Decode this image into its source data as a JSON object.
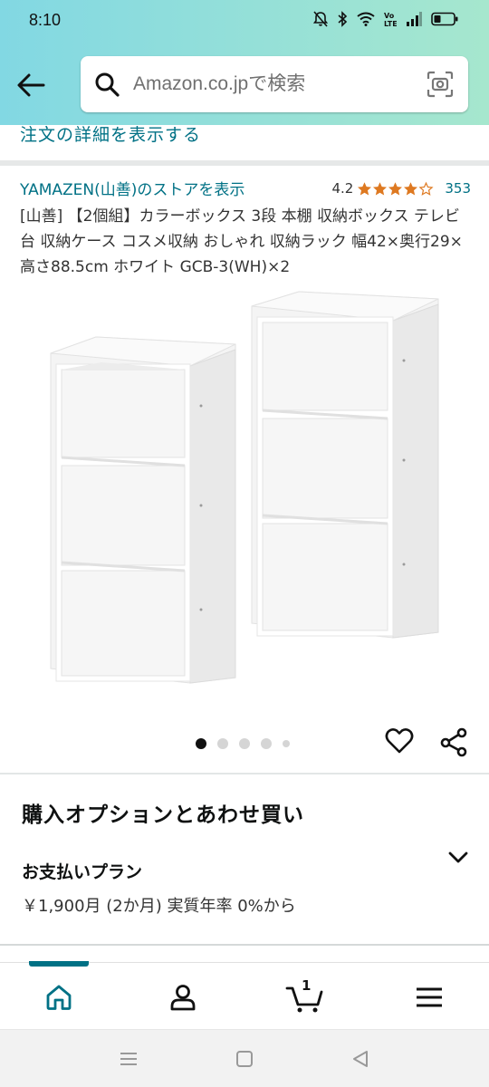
{
  "status_bar": {
    "time": "8:10",
    "icons": [
      "bell-off-icon",
      "bluetooth-icon",
      "wifi-icon",
      "volte-icon",
      "signal-icon",
      "battery-icon"
    ]
  },
  "search": {
    "placeholder": "Amazon.co.jpで検索",
    "back_icon": "back-arrow-icon",
    "search_icon": "search-icon",
    "camera_icon": "camera-scan-icon"
  },
  "order_details_link": "注文の詳細を表示する",
  "product": {
    "store_link": "YAMAZEN(山善)のストアを表示",
    "rating": "4.2",
    "rating_stars": 4.2,
    "review_count": "353",
    "title": "[山善] 【2個組】カラーボックス 3段 本棚 収納ボックス テレビ台 収納ケース コスメ収納 おしゃれ 収納ラック 幅42×奥行29×高さ88.5cm ホワイト GCB-3(WH)×2",
    "image_count": 5,
    "active_image": 1
  },
  "purchase_options": {
    "section_title": "購入オプションとあわせ買い",
    "plan_label": "お支払いプラン",
    "plan_value": "￥1,900月 (2か月) 実質年率 0%から"
  },
  "bottom_nav": {
    "items": [
      "home-icon",
      "account-icon",
      "cart-icon",
      "menu-icon"
    ],
    "cart_count": "1",
    "active": "home"
  },
  "colors": {
    "link": "#007185",
    "star": "#de7921",
    "header_left": "#82d8e3",
    "header_right": "#a6e7ce"
  }
}
